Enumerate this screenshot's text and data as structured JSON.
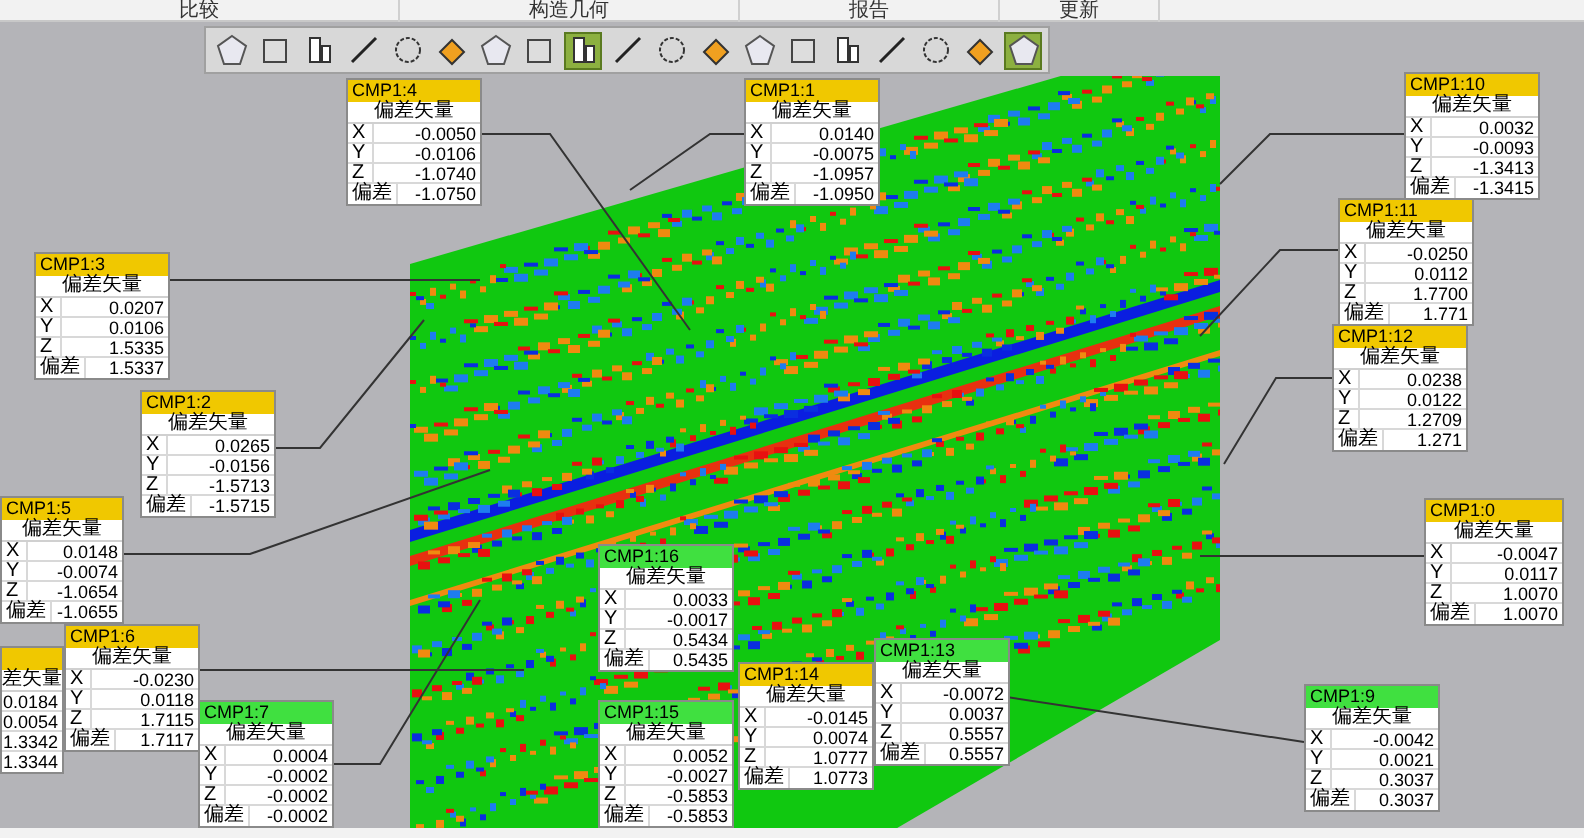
{
  "menu_tabs": [
    {
      "label": "比较"
    },
    {
      "label": "构造几何"
    },
    {
      "label": "报告"
    },
    {
      "label": "更新"
    }
  ],
  "toolbar": {
    "buttons": [
      {
        "selected": false
      },
      {
        "selected": false
      },
      {
        "selected": false
      },
      {
        "selected": false
      },
      {
        "selected": false
      },
      {
        "selected": false
      },
      {
        "selected": false
      },
      {
        "selected": false
      },
      {
        "selected": true
      },
      {
        "selected": false
      },
      {
        "selected": false
      },
      {
        "selected": false
      },
      {
        "selected": false
      },
      {
        "selected": false
      },
      {
        "selected": false
      },
      {
        "selected": false
      },
      {
        "selected": false
      },
      {
        "selected": false
      },
      {
        "selected": true
      }
    ]
  },
  "callouts": [
    {
      "title": "CMP1:4",
      "color": "#f0c800",
      "heading": "偏差矢量",
      "rows": [
        {
          "label": "X",
          "value": "-0.0050"
        },
        {
          "label": "Y",
          "value": "-0.0106"
        },
        {
          "label": "Z",
          "value": "-1.0740"
        },
        {
          "label": "偏差",
          "value": "-1.0750"
        }
      ]
    },
    {
      "title": "CMP1:1",
      "color": "#f0c800",
      "heading": "偏差矢量",
      "rows": [
        {
          "label": "X",
          "value": "0.0140"
        },
        {
          "label": "Y",
          "value": "-0.0075"
        },
        {
          "label": "Z",
          "value": "-1.0957"
        },
        {
          "label": "偏差",
          "value": "-1.0950"
        }
      ]
    },
    {
      "title": "CMP1:10",
      "color": "#f0c800",
      "heading": "偏差矢量",
      "rows": [
        {
          "label": "X",
          "value": "0.0032"
        },
        {
          "label": "Y",
          "value": "-0.0093"
        },
        {
          "label": "Z",
          "value": "-1.3413"
        },
        {
          "label": "偏差",
          "value": "-1.3415"
        }
      ]
    },
    {
      "title": "CMP1:11",
      "color": "#f0c800",
      "heading": "偏差矢量",
      "rows": [
        {
          "label": "X",
          "value": "-0.0250"
        },
        {
          "label": "Y",
          "value": "0.0112"
        },
        {
          "label": "Z",
          "value": "1.7700"
        },
        {
          "label": "偏差",
          "value": "1.771"
        }
      ]
    },
    {
      "title": "CMP1:12",
      "color": "#f0c800",
      "heading": "偏差矢量",
      "rows": [
        {
          "label": "X",
          "value": "0.0238"
        },
        {
          "label": "Y",
          "value": "0.0122"
        },
        {
          "label": "Z",
          "value": "1.2709"
        },
        {
          "label": "偏差",
          "value": "1.271"
        }
      ]
    },
    {
      "title": "CMP1:3",
      "color": "#f0c800",
      "heading": "偏差矢量",
      "rows": [
        {
          "label": "X",
          "value": "0.0207"
        },
        {
          "label": "Y",
          "value": "0.0106"
        },
        {
          "label": "Z",
          "value": "1.5335"
        },
        {
          "label": "偏差",
          "value": "1.5337"
        }
      ]
    },
    {
      "title": "CMP1:2",
      "color": "#f0c800",
      "heading": "偏差矢量",
      "rows": [
        {
          "label": "X",
          "value": "0.0265"
        },
        {
          "label": "Y",
          "value": "-0.0156"
        },
        {
          "label": "Z",
          "value": "-1.5713"
        },
        {
          "label": "偏差",
          "value": "-1.5715"
        }
      ]
    },
    {
      "title": "CMP1:5",
      "color": "#f0c800",
      "heading": "偏差矢量",
      "rows": [
        {
          "label": "X",
          "value": "0.0148"
        },
        {
          "label": "Y",
          "value": "-0.0074"
        },
        {
          "label": "Z",
          "value": "-1.0654"
        },
        {
          "label": "偏差",
          "value": "-1.0655"
        }
      ]
    },
    {
      "title": "CMP1:0",
      "color": "#f0c800",
      "heading": "偏差矢量",
      "rows": [
        {
          "label": "X",
          "value": "-0.0047"
        },
        {
          "label": "Y",
          "value": "0.0117"
        },
        {
          "label": "Z",
          "value": "1.0070"
        },
        {
          "label": "偏差",
          "value": "1.0070"
        }
      ]
    },
    {
      "color": "#f0c800",
      "heading": "差矢量",
      "rows": [
        {
          "value": "0.0184"
        },
        {
          "value": "0.0054"
        },
        {
          "value": "1.3342"
        },
        {
          "value": "1.3344"
        }
      ]
    },
    {
      "title": "CMP1:6",
      "color": "#f0c800",
      "heading": "偏差矢量",
      "rows": [
        {
          "label": "X",
          "value": "-0.0230"
        },
        {
          "label": "Y",
          "value": "0.0118"
        },
        {
          "label": "Z",
          "value": "1.7115"
        },
        {
          "label": "偏差",
          "value": "1.7117"
        }
      ]
    },
    {
      "title": "CMP1:7",
      "color": "#40e040",
      "heading": "偏差矢量",
      "rows": [
        {
          "label": "X",
          "value": "0.0004"
        },
        {
          "label": "Y",
          "value": "-0.0002"
        },
        {
          "label": "Z",
          "value": "-0.0002"
        },
        {
          "label": "偏差",
          "value": "-0.0002"
        }
      ]
    },
    {
      "title": "CMP1:16",
      "color": "#40e040",
      "heading": "偏差矢量",
      "rows": [
        {
          "label": "X",
          "value": "0.0033"
        },
        {
          "label": "Y",
          "value": "-0.0017"
        },
        {
          "label": "Z",
          "value": "0.5434"
        },
        {
          "label": "偏差",
          "value": "0.5435"
        }
      ]
    },
    {
      "title": "CMP1:15",
      "color": "#40e040",
      "heading": "偏差矢量",
      "rows": [
        {
          "label": "X",
          "value": "0.0052"
        },
        {
          "label": "Y",
          "value": "-0.0027"
        },
        {
          "label": "Z",
          "value": "-0.5853"
        },
        {
          "label": "偏差",
          "value": "-0.5853"
        }
      ]
    },
    {
      "title": "CMP1:14",
      "color": "#f0c800",
      "heading": "偏差矢量",
      "rows": [
        {
          "label": "X",
          "value": "-0.0145"
        },
        {
          "label": "Y",
          "value": "0.0074"
        },
        {
          "label": "Z",
          "value": "1.0777"
        },
        {
          "label": "偏差",
          "value": "1.0773"
        }
      ]
    },
    {
      "title": "CMP1:13",
      "color": "#40e040",
      "heading": "偏差矢量",
      "rows": [
        {
          "label": "X",
          "value": "-0.0072"
        },
        {
          "label": "Y",
          "value": "0.0037"
        },
        {
          "label": "Z",
          "value": "0.5557"
        },
        {
          "label": "偏差",
          "value": "0.5557"
        }
      ]
    },
    {
      "title": "CMP1:9",
      "color": "#40e040",
      "heading": "偏差矢量",
      "rows": [
        {
          "label": "X",
          "value": "-0.0042"
        },
        {
          "label": "Y",
          "value": "0.0021"
        },
        {
          "label": "Z",
          "value": "0.3037"
        },
        {
          "label": "偏差",
          "value": "0.3037"
        }
      ]
    }
  ]
}
